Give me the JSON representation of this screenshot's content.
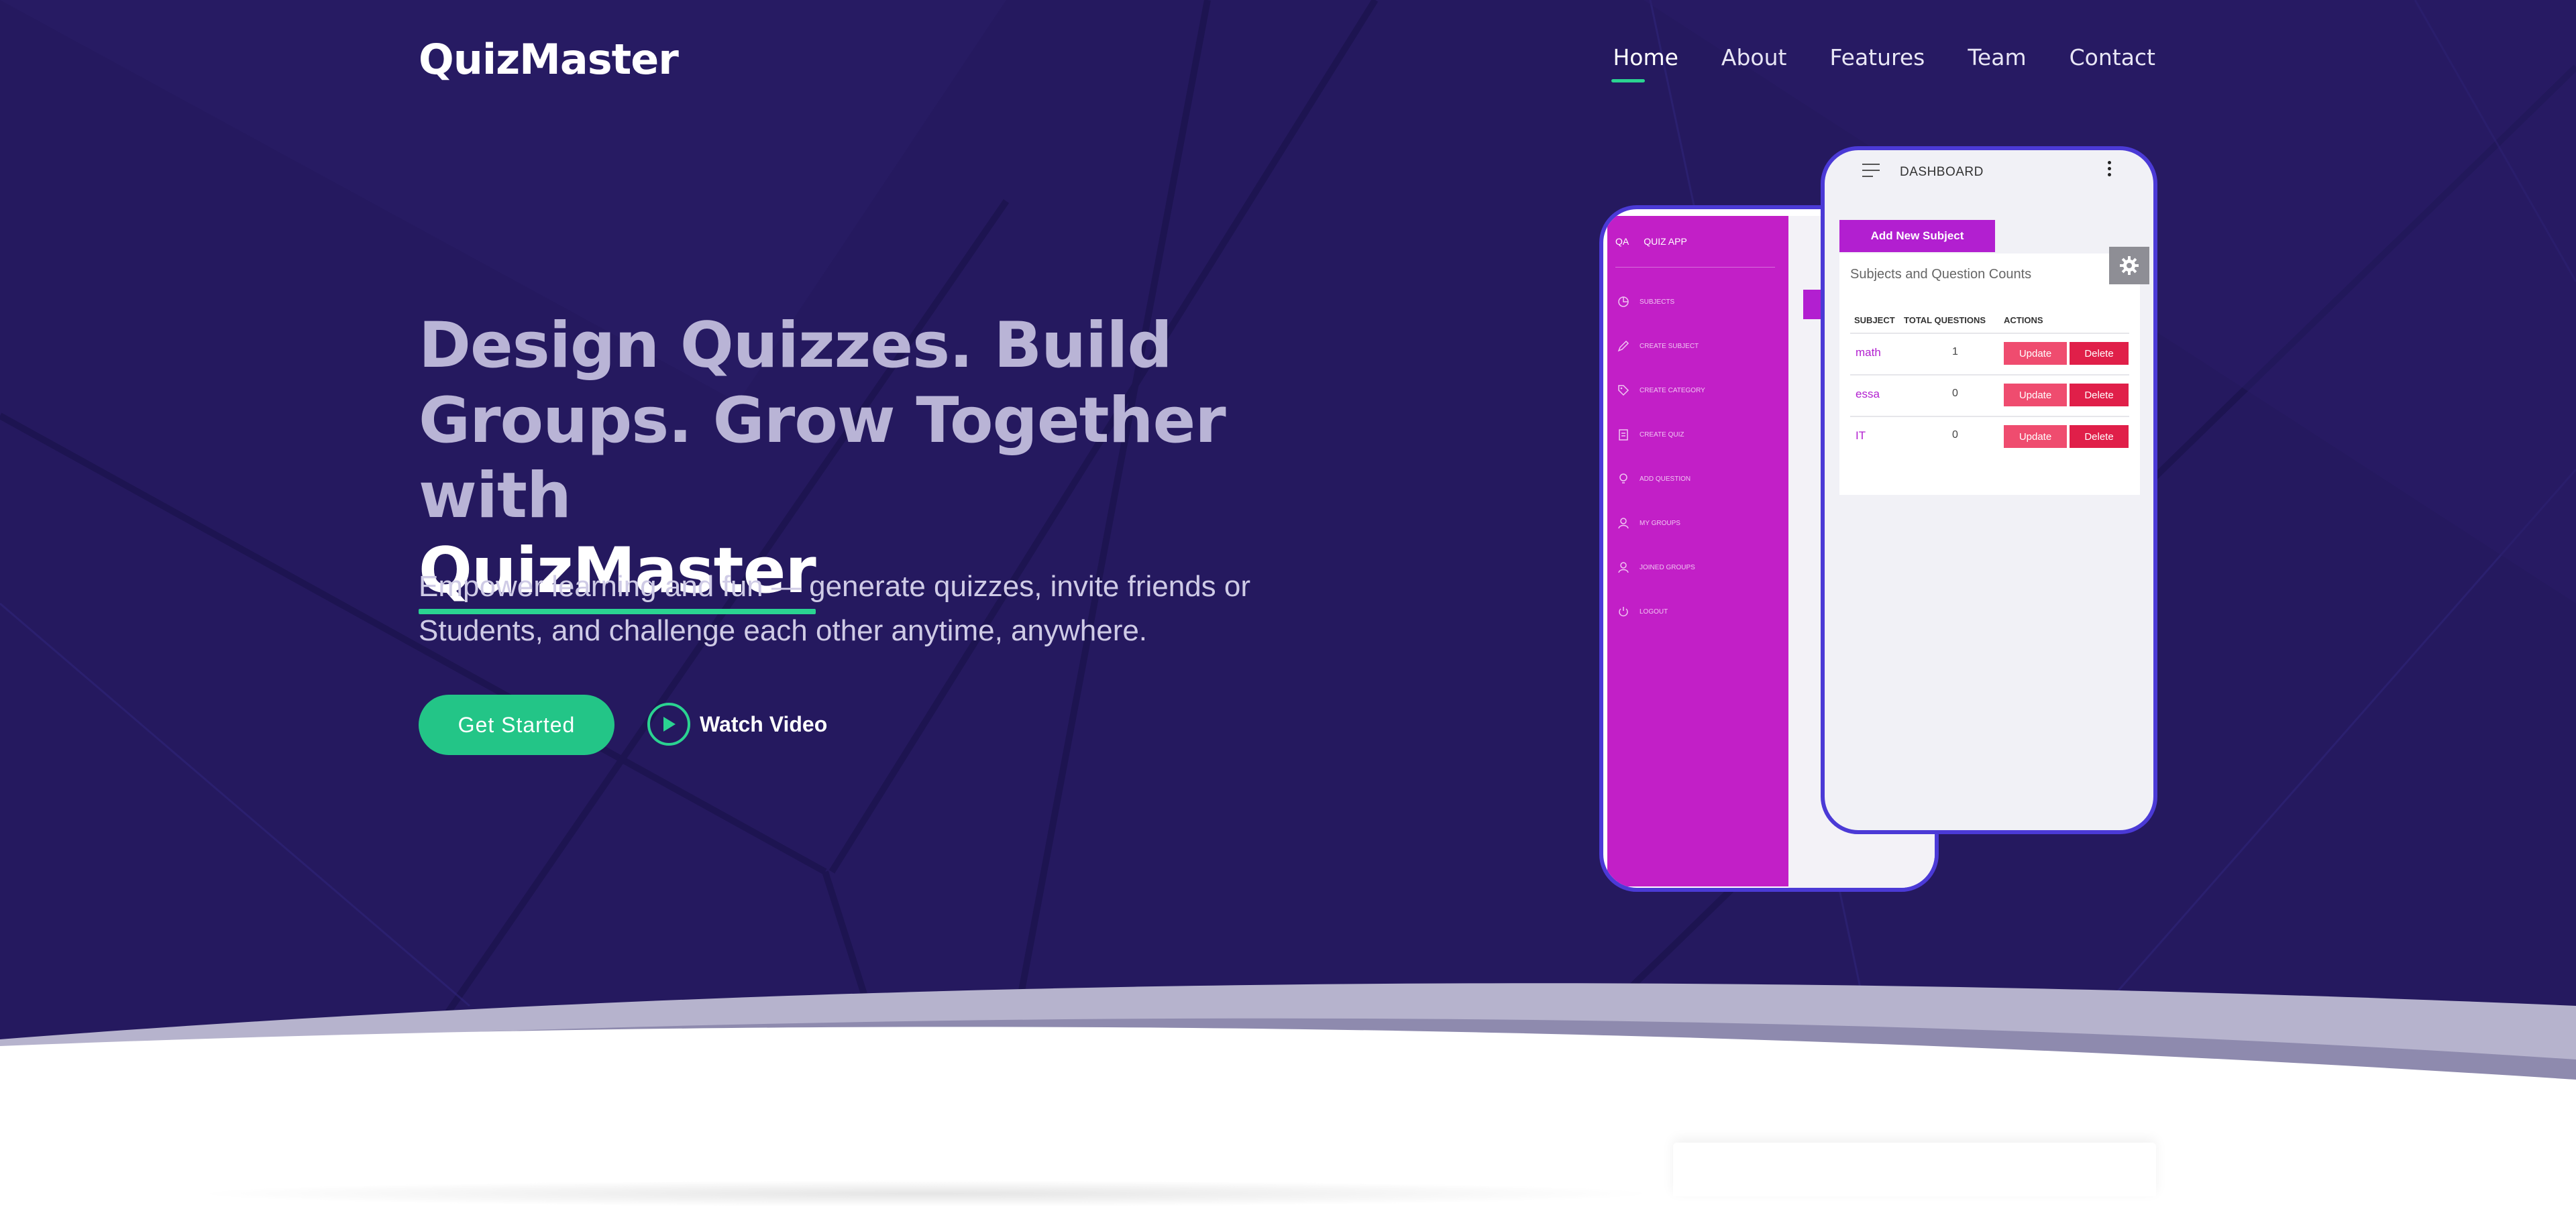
{
  "brand": {
    "name": "QuizMaster"
  },
  "nav": {
    "items": [
      {
        "label": "Home",
        "active": true
      },
      {
        "label": "About"
      },
      {
        "label": "Features"
      },
      {
        "label": "Team"
      },
      {
        "label": "Contact"
      }
    ]
  },
  "hero": {
    "headline_dim": "Design Quizzes. Build Groups. Grow Together with",
    "headline_brand": "QuizMaster",
    "subtitle": "Empower learning and fun — generate quizzes, invite friends or Students, and challenge each other anytime, anywhere.",
    "primary_cta": "Get Started",
    "video_cta": "Watch Video"
  },
  "mockup": {
    "app_abbr": "QA",
    "app_name": "QUIZ APP",
    "sidebar": [
      {
        "label": "SUBJECTS",
        "icon": "chart-icon"
      },
      {
        "label": "CREATE SUBJECT",
        "icon": "pencil-icon"
      },
      {
        "label": "CREATE CATEGORY",
        "icon": "tag-icon"
      },
      {
        "label": "CREATE QUIZ",
        "icon": "clipboard-icon"
      },
      {
        "label": "ADD QUESTION",
        "icon": "bulb-icon"
      },
      {
        "label": "MY GROUPS",
        "icon": "user-icon"
      },
      {
        "label": "JOINED GROUPS",
        "icon": "user-icon"
      },
      {
        "label": "LOGOUT",
        "icon": "power-icon"
      }
    ],
    "dashboard_title": "DASHBOARD",
    "add_button": "Add New Subject",
    "card_title": "Subjects and Question Counts",
    "columns": [
      "SUBJECT",
      "TOTAL QUESTIONS",
      "ACTIONS"
    ],
    "rows": [
      {
        "subject": "math",
        "count": "1"
      },
      {
        "subject": "essa",
        "count": "0"
      },
      {
        "subject": "IT",
        "count": "0"
      }
    ],
    "update_label": "Update",
    "delete_label": "Delete"
  },
  "colors": {
    "hero_bg": "#25195f",
    "accent_green": "#2bd391",
    "sidebar_magenta": "#c21fc7",
    "phone_frame": "#4b3ad6"
  }
}
